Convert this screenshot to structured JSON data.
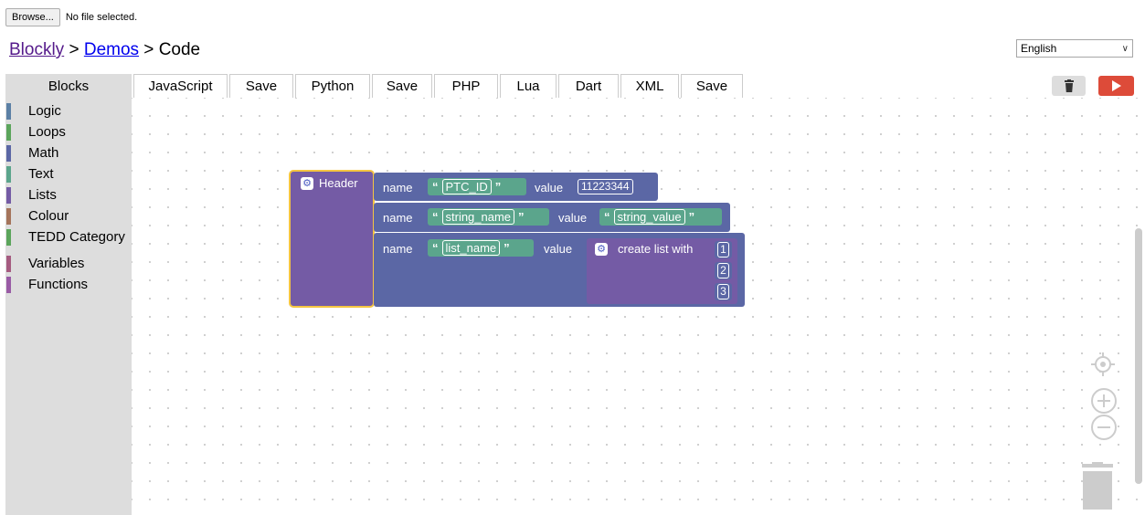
{
  "file_input": {
    "button_label": "Browse...",
    "status": "No file selected."
  },
  "breadcrumb": {
    "blockly": "Blockly",
    "sep1": " > ",
    "demos": "Demos",
    "sep2": " > ",
    "current": "Code"
  },
  "language": {
    "selected": "English"
  },
  "tabs": [
    {
      "label": "Blocks",
      "active": true
    },
    {
      "label": "JavaScript"
    },
    {
      "label": "Save"
    },
    {
      "label": "Python"
    },
    {
      "label": "Save"
    },
    {
      "label": "PHP"
    },
    {
      "label": "Lua"
    },
    {
      "label": "Dart"
    },
    {
      "label": "XML"
    },
    {
      "label": "Save"
    }
  ],
  "toolbox": {
    "categories": [
      {
        "label": "Logic",
        "color": "#5b80a5"
      },
      {
        "label": "Loops",
        "color": "#5ba55b"
      },
      {
        "label": "Math",
        "color": "#5b67a5"
      },
      {
        "label": "Text",
        "color": "#5ba58c"
      },
      {
        "label": "Lists",
        "color": "#745ba5"
      },
      {
        "label": "Colour",
        "color": "#a5745b"
      },
      {
        "label": "TEDD Category",
        "color": "#5ba55b"
      },
      {
        "label": "Variables",
        "color": "#a55b80"
      },
      {
        "label": "Functions",
        "color": "#995ba5"
      }
    ]
  },
  "workspace": {
    "header_block": {
      "label": "Header"
    },
    "rows": [
      {
        "name_label": "name",
        "name_value": "PTC_ID",
        "value_label": "value",
        "value": "11223344"
      },
      {
        "name_label": "name",
        "name_value": "string_name",
        "value_label": "value",
        "value": "string_value"
      },
      {
        "name_label": "name",
        "name_value": "list_name",
        "value_label": "value",
        "list_label": "create list with",
        "items": [
          "1",
          "2",
          "3"
        ]
      }
    ]
  },
  "colors": {
    "run": "#dd4b39",
    "trash_bg": "#dddddd",
    "highlight": "#f5c542"
  }
}
